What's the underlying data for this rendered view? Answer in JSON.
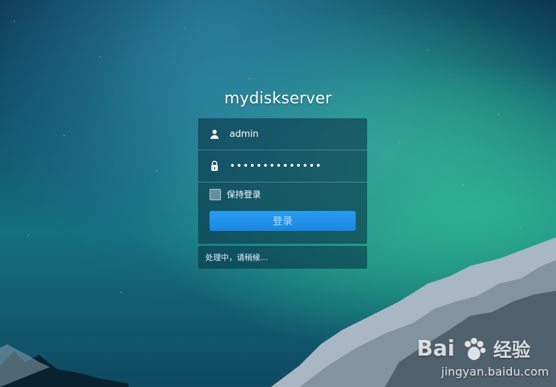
{
  "app": {
    "server_name": "mydiskserver"
  },
  "login_form": {
    "username_value": "admin",
    "password_mask": "••••••••••••••",
    "remember_label": "保持登录",
    "login_button_label": "登录",
    "status_message": "处理中，请稍候..."
  },
  "watermark": {
    "brand": "Bai",
    "brand_suffix": "经验",
    "url": "jingyan.baidu.com"
  },
  "colors": {
    "accent": "#1a86e2",
    "panel_bg": "#062a3f",
    "text": "#ffffff"
  },
  "icons": {
    "user": "user-icon",
    "lock": "lock-icon",
    "paw": "paw-icon"
  }
}
